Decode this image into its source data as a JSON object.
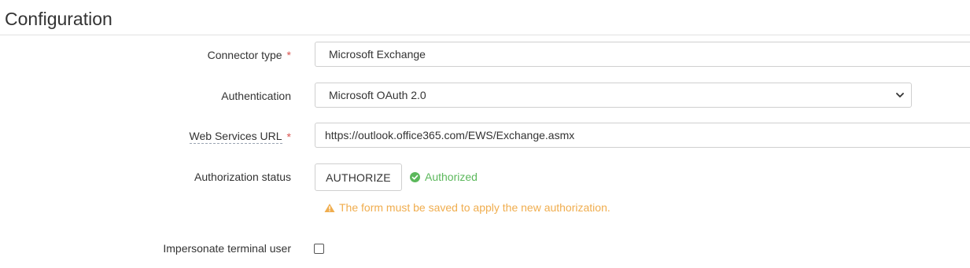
{
  "section": {
    "title": "Configuration"
  },
  "form": {
    "connector_type": {
      "label": "Connector type",
      "required_mark": "*",
      "value": "Microsoft Exchange"
    },
    "authentication": {
      "label": "Authentication",
      "selected": "Microsoft OAuth 2.0"
    },
    "web_services_url": {
      "label": "Web Services URL",
      "required_mark": "*",
      "value": "https://outlook.office365.com/EWS/Exchange.asmx"
    },
    "authorization_status": {
      "label": "Authorization status",
      "button_label": "AUTHORIZE",
      "status_text": "Authorized",
      "warning_text": "The form must be saved to apply the new authorization."
    },
    "impersonate": {
      "label": "Impersonate terminal user",
      "checked": false
    }
  },
  "colors": {
    "required": "#d9534f",
    "success": "#5cb85c",
    "warning": "#f0ad4e"
  },
  "icons": {
    "status": "check-circle-icon",
    "warning": "warning-triangle-icon",
    "select": "chevron-down-icon"
  }
}
